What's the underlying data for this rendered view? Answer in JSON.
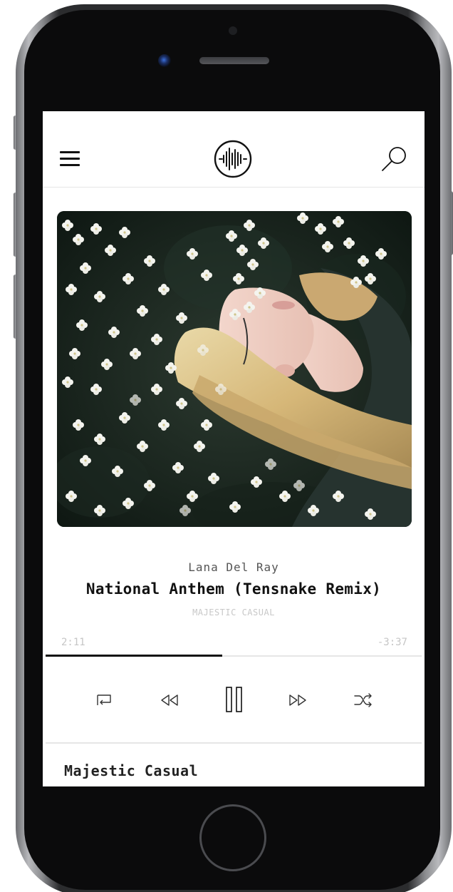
{
  "header": {
    "menu_icon": "hamburger-menu-icon",
    "logo_icon": "soundwave-logo-icon",
    "search_icon": "search-icon"
  },
  "now_playing": {
    "artist": "Lana Del Ray",
    "title": "National Anthem (Tensnake Remix)",
    "channel": "MAJESTIC CASUAL",
    "elapsed": "2:11",
    "remaining": "-3:37",
    "progress": 0.47
  },
  "controls": {
    "icons": [
      "repeat-icon",
      "rewind-icon",
      "pause-icon",
      "fast-forward-icon",
      "shuffle-icon"
    ]
  },
  "playlist": {
    "title": "Majestic Casual"
  },
  "colors": {
    "accent": "#111111",
    "muted_text": "#c6c6c6",
    "divider": "#e6e6e6"
  }
}
